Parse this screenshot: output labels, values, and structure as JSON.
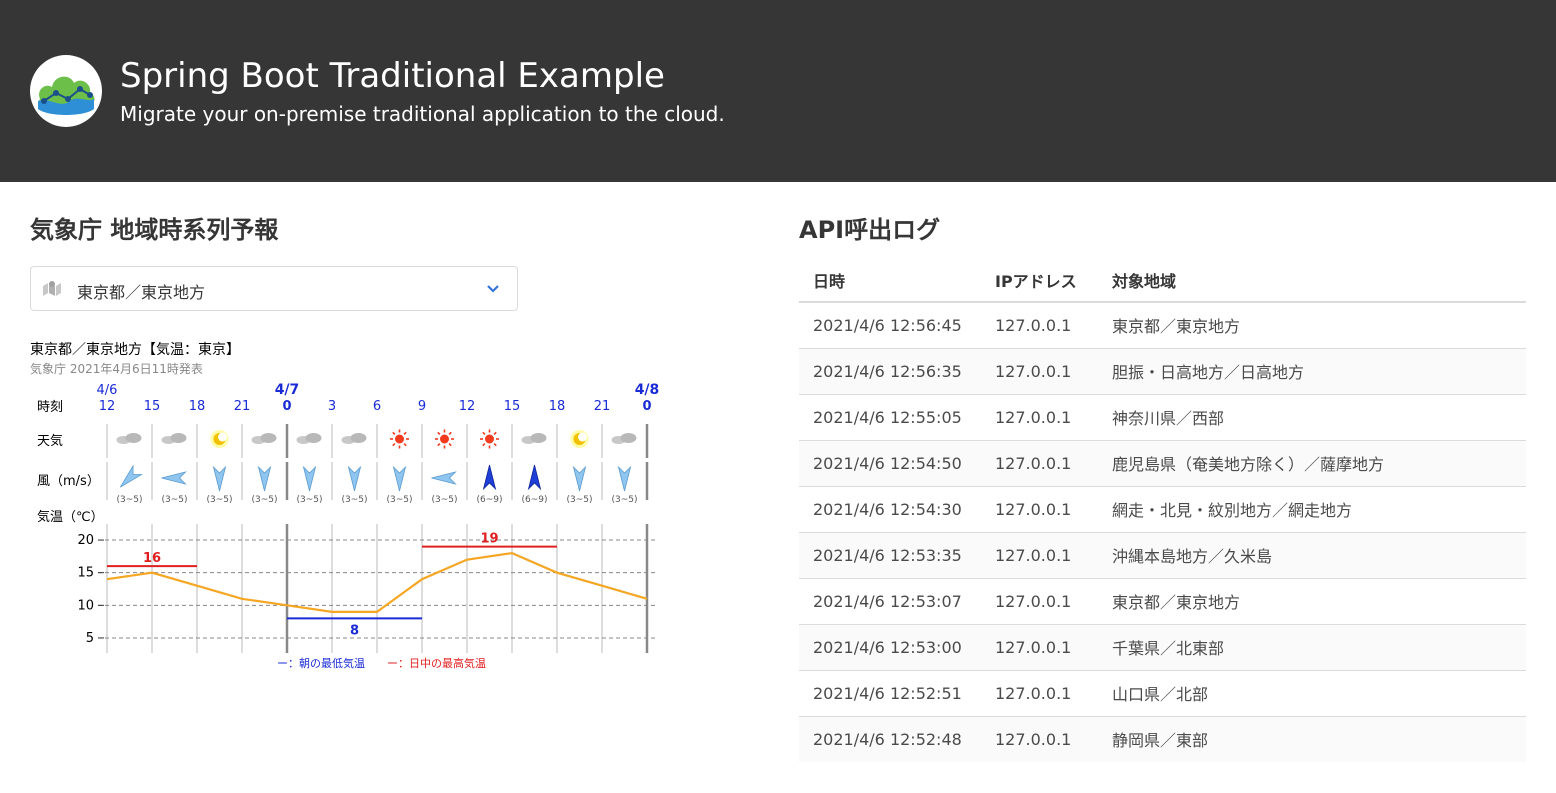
{
  "header": {
    "title": "Spring Boot Traditional Example",
    "subtitle": "Migrate your on-premise traditional application to the cloud."
  },
  "forecast_section": {
    "title": "気象庁 地域時系列予報",
    "select": {
      "selected": "東京都／東京地方",
      "icon": "map-icon"
    },
    "chart_title": "東京都／東京地方【気温：東京】",
    "chart_source": "気象庁 2021年4月6日11時発表"
  },
  "chart_data": {
    "type": "line",
    "row_labels": {
      "time": "時刻",
      "weather": "天気",
      "wind": "風（m/s）",
      "temp": "気温（℃）"
    },
    "dates": [
      {
        "label": "4/6",
        "index": 0,
        "bold": false
      },
      {
        "label": "4/7",
        "index": 4,
        "bold": true
      },
      {
        "label": "4/8",
        "index": 12,
        "bold": true
      }
    ],
    "hours": [
      "12",
      "15",
      "18",
      "21",
      "0",
      "3",
      "6",
      "9",
      "12",
      "15",
      "18",
      "21",
      "0"
    ],
    "weather": [
      "cloudy",
      "cloudy",
      "clear-night",
      "cloudy",
      "cloudy",
      "cloudy",
      "sunny",
      "sunny",
      "sunny",
      "cloudy",
      "clear-night",
      "cloudy"
    ],
    "wind": [
      {
        "dir": "NE",
        "strength": "(3~5)"
      },
      {
        "dir": "E",
        "strength": "(3~5)"
      },
      {
        "dir": "N",
        "strength": "(3~5)"
      },
      {
        "dir": "N",
        "strength": "(3~5)"
      },
      {
        "dir": "N",
        "strength": "(3~5)"
      },
      {
        "dir": "N",
        "strength": "(3~5)"
      },
      {
        "dir": "N",
        "strength": "(3~5)"
      },
      {
        "dir": "E",
        "strength": "(3~5)"
      },
      {
        "dir": "S",
        "strength": "(6~9)"
      },
      {
        "dir": "S",
        "strength": "(6~9)"
      },
      {
        "dir": "N",
        "strength": "(3~5)"
      },
      {
        "dir": "N",
        "strength": "(3~5)"
      }
    ],
    "temperature": [
      14,
      15,
      13,
      11,
      10,
      9,
      9,
      14,
      17,
      18,
      15,
      13,
      11
    ],
    "y_ticks": [
      "20",
      "15",
      "10",
      "5"
    ],
    "ylim": [
      3,
      22
    ],
    "min_temp": {
      "value": "8",
      "from_index": 4,
      "to_index": 7
    },
    "max_temps": [
      {
        "value": "16",
        "from_index": 0,
        "to_index": 2
      },
      {
        "value": "19",
        "from_index": 7,
        "to_index": 10
      }
    ],
    "legend": {
      "min": "ー：朝の最低気温",
      "max": "ー：日中の最高気温"
    },
    "colors": {
      "line": "#f5a623",
      "max": "#e02020",
      "min": "#1a2bd6",
      "hour": "#1a2bd6"
    }
  },
  "log_section": {
    "title": "API呼出ログ",
    "columns": [
      "日時",
      "IPアドレス",
      "対象地域"
    ],
    "rows": [
      [
        "2021/4/6 12:56:45",
        "127.0.0.1",
        "東京都／東京地方"
      ],
      [
        "2021/4/6 12:56:35",
        "127.0.0.1",
        "胆振・日高地方／日高地方"
      ],
      [
        "2021/4/6 12:55:05",
        "127.0.0.1",
        "神奈川県／西部"
      ],
      [
        "2021/4/6 12:54:50",
        "127.0.0.1",
        "鹿児島県（奄美地方除く）／薩摩地方"
      ],
      [
        "2021/4/6 12:54:30",
        "127.0.0.1",
        "網走・北見・紋別地方／網走地方"
      ],
      [
        "2021/4/6 12:53:35",
        "127.0.0.1",
        "沖縄本島地方／久米島"
      ],
      [
        "2021/4/6 12:53:07",
        "127.0.0.1",
        "東京都／東京地方"
      ],
      [
        "2021/4/6 12:53:00",
        "127.0.0.1",
        "千葉県／北東部"
      ],
      [
        "2021/4/6 12:52:51",
        "127.0.0.1",
        "山口県／北部"
      ],
      [
        "2021/4/6 12:52:48",
        "127.0.0.1",
        "静岡県／東部"
      ]
    ]
  }
}
